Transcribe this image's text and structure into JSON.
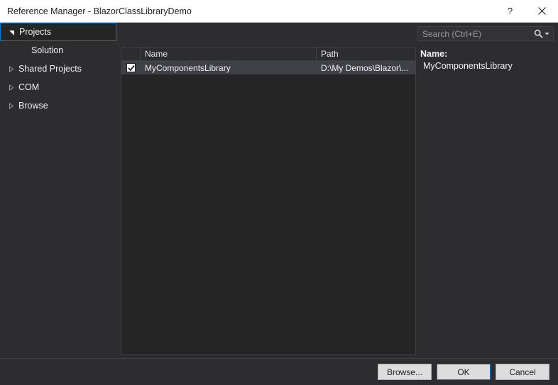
{
  "window": {
    "title": "Reference Manager - BlazorClassLibraryDemo",
    "help_label": "?",
    "close_label": "×"
  },
  "sidebar": {
    "items": [
      {
        "label": "Projects",
        "state": "expanded",
        "selected": true,
        "child": false
      },
      {
        "label": "Solution",
        "state": "leaf",
        "selected": false,
        "child": true
      },
      {
        "label": "Shared Projects",
        "state": "collapsed",
        "selected": false,
        "child": false
      },
      {
        "label": "COM",
        "state": "collapsed",
        "selected": false,
        "child": false
      },
      {
        "label": "Browse",
        "state": "collapsed",
        "selected": false,
        "child": false
      }
    ]
  },
  "search": {
    "value": "",
    "placeholder": "Search (Ctrl+E)"
  },
  "list": {
    "columns": [
      "",
      "Name",
      "Path"
    ],
    "rows": [
      {
        "checked": true,
        "name": "MyComponentsLibrary",
        "path": "D:\\My Demos\\Blazor\\...",
        "selected": true
      }
    ]
  },
  "details": {
    "name_label": "Name:",
    "name_value": "MyComponentsLibrary"
  },
  "footer": {
    "browse_label": "Browse...",
    "ok_label": "OK",
    "cancel_label": "Cancel"
  },
  "colors": {
    "accent": "#007acc",
    "dialog_bg": "#2d2d30",
    "panel_bg": "#252526",
    "selection_bg": "#3f3f46",
    "titlebar_bg": "#ffffff",
    "button_bg": "#dddddd"
  }
}
